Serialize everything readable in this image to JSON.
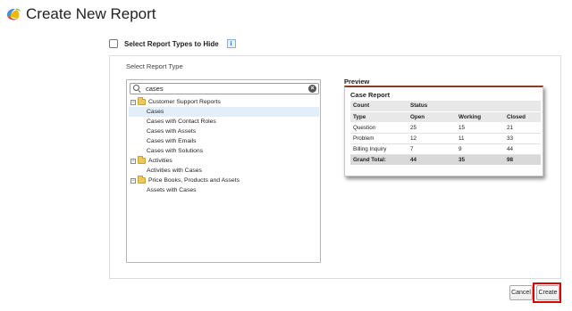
{
  "header": {
    "title": "Create New Report",
    "logo_icon": "salesforce-logo"
  },
  "options": {
    "hide_label": "Select Report Types to Hide",
    "info_icon": "i"
  },
  "report_type": {
    "section_title": "Select Report Type",
    "search_value": "cases",
    "clear_icon": "×",
    "tree": [
      {
        "type": "folder",
        "label": "Customer Support Reports",
        "toggle": "−"
      },
      {
        "type": "leaf",
        "label": "Cases",
        "selected": true
      },
      {
        "type": "leaf",
        "label": "Cases with Contact Roles"
      },
      {
        "type": "leaf",
        "label": "Cases with Assets"
      },
      {
        "type": "leaf",
        "label": "Cases with Emails"
      },
      {
        "type": "leaf",
        "label": "Cases with Solutions"
      },
      {
        "type": "folder",
        "label": "Activities",
        "toggle": "−"
      },
      {
        "type": "leaf",
        "label": "Activities with Cases"
      },
      {
        "type": "folder",
        "label": "Price Books, Products and Assets",
        "toggle": "−"
      },
      {
        "type": "leaf",
        "label": "Assets with Cases"
      }
    ]
  },
  "preview": {
    "label": "Preview",
    "card_title": "Case Report",
    "header_rows": [
      [
        "Count",
        "Status",
        "",
        ""
      ],
      [
        "Type",
        "Open",
        "Working",
        "Closed"
      ]
    ],
    "rows": [
      [
        "Question",
        "25",
        "15",
        "21"
      ],
      [
        "Problem",
        "12",
        "11",
        "33"
      ],
      [
        "Billing Inquiry",
        "7",
        "9",
        "44"
      ]
    ],
    "total": [
      "Grand Total:",
      "44",
      "35",
      "98"
    ]
  },
  "actions": {
    "cancel": "Cancel",
    "create": "Create",
    "highlight_color": "#e00000"
  }
}
